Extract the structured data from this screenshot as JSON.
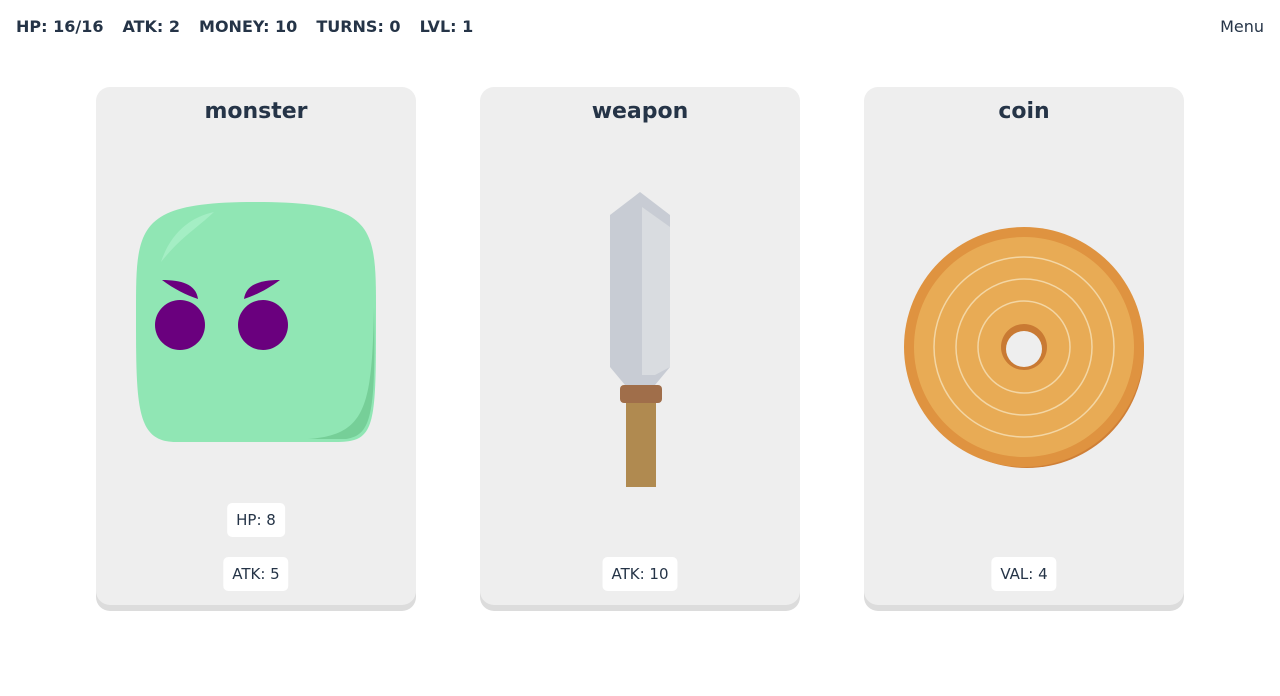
{
  "hud": {
    "hp": "HP: 16/16",
    "atk": "ATK: 2",
    "money": "MONEY: 10",
    "turns": "TURNS: 0",
    "lvl": "LVL: 1"
  },
  "menu": "Menu",
  "cards": [
    {
      "title": "monster",
      "stats": [
        "HP: 8",
        "ATK: 5"
      ]
    },
    {
      "title": "weapon",
      "stats": [
        "ATK: 10"
      ]
    },
    {
      "title": "coin",
      "stats": [
        "VAL: 4"
      ]
    }
  ],
  "colors": {
    "monster": "#90e6b4",
    "eyes": "#6a007e",
    "blade": "#c8ccd4",
    "handle": "#a06e4a",
    "coin": "#e8ab55"
  }
}
